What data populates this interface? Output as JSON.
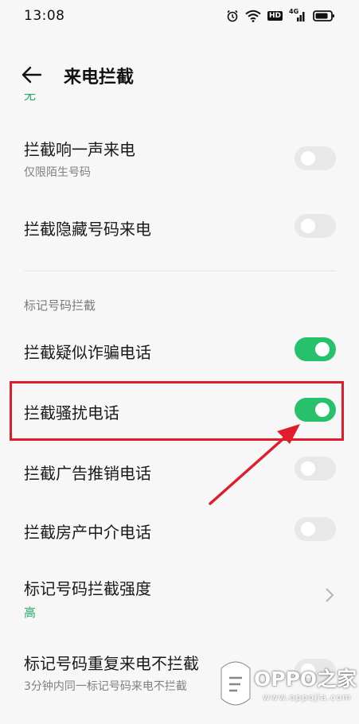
{
  "status_bar": {
    "time": "13:08",
    "icons": [
      "alarm-icon",
      "wifi-icon",
      "hd-icon",
      "signal-4g-icon",
      "battery-icon"
    ],
    "network": "4G",
    "hd": "HD"
  },
  "header": {
    "back_icon": "back-arrow-icon",
    "title": "来电拦截"
  },
  "partial_top_text": "无",
  "settings": [
    {
      "title": "拦截响一声来电",
      "subtitle": "仅限陌生号码",
      "toggle": false
    },
    {
      "title": "拦截隐藏号码来电",
      "toggle": false
    }
  ],
  "section": {
    "header": "标记号码拦截",
    "items": [
      {
        "title": "拦截疑似诈骗电话",
        "toggle": true
      },
      {
        "title": "拦截骚扰电话",
        "toggle": true
      },
      {
        "title": "拦截广告推销电话",
        "toggle": false
      },
      {
        "title": "拦截房产中介电话",
        "toggle": false
      },
      {
        "title": "标记号码拦截强度",
        "value": "高",
        "chevron": "chevron-right-icon"
      },
      {
        "title": "标记号码重复来电不拦截",
        "subtitle": "3分钟内同一标记号码来电不拦截",
        "toggle": false
      }
    ]
  },
  "colors": {
    "accent": "#27c16b",
    "highlight": "#e01e2b",
    "background": "#f7f7f7"
  },
  "watermark": {
    "text": "OPPO之家",
    "url": "www.oppojia.com"
  }
}
